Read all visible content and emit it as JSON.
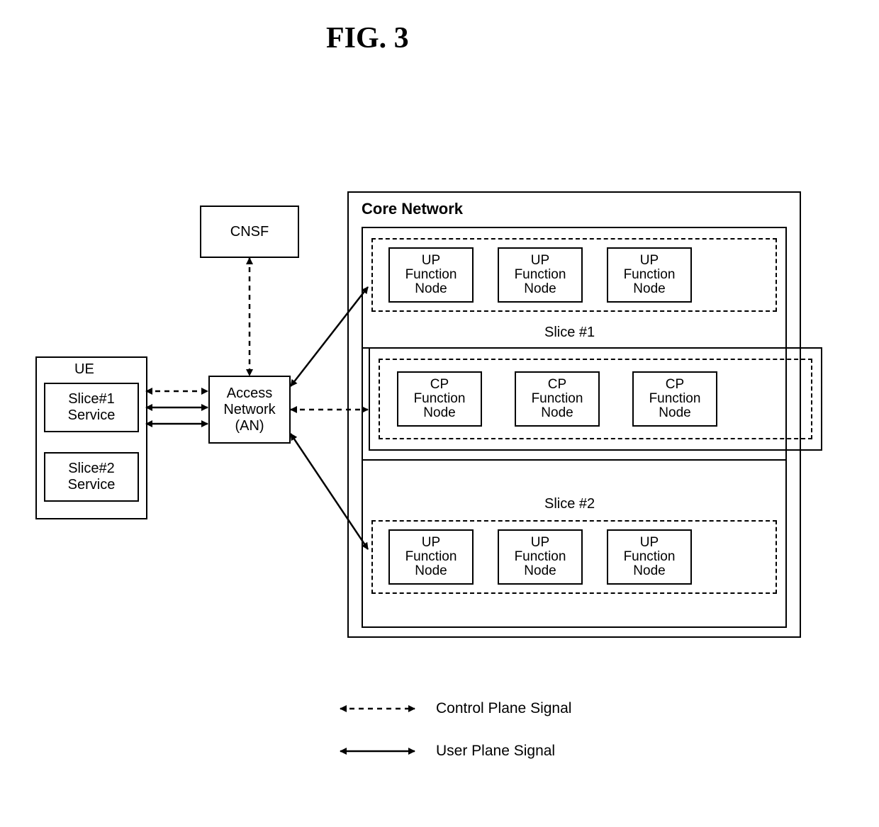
{
  "figure_title": "FIG. 3",
  "ue": {
    "title": "UE",
    "service1": "Slice#1\nService",
    "service2": "Slice#2\nService"
  },
  "an": "Access\nNetwork\n(AN)",
  "cnsf": "CNSF",
  "core": {
    "title": "Core Network",
    "slice1_label": "Slice #1",
    "slice2_label": "Slice #2",
    "up_node": "UP\nFunction\nNode",
    "cp_node": "CP\nFunction\nNode"
  },
  "legend": {
    "control": "Control Plane Signal",
    "user": "User Plane Signal"
  }
}
